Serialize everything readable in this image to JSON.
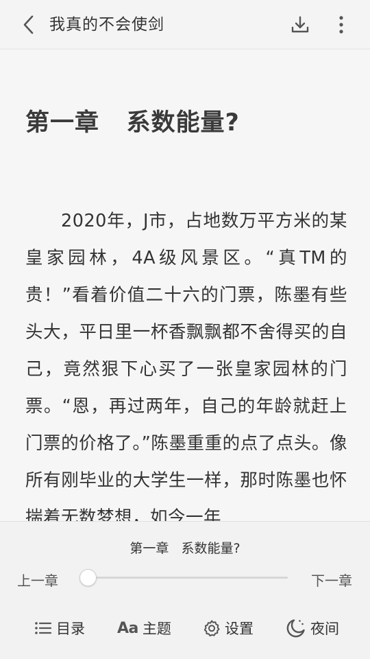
{
  "header": {
    "book_title": "我真的不会使剑",
    "back_icon": "chevron-left-icon",
    "download_icon": "download-icon",
    "more_icon": "more-vertical-icon"
  },
  "content": {
    "chapter_title": "第一章   系数能量?",
    "paragraph": "2020年，J市，占地数万平方米的某皇家园林，4A级风景区。“真TM的贵！”看着价值二十六的门票，陈墨有些头大，平日里一杯香飘飘都不舍得买的自己，竟然狠下心买了一张皇家园林的门票。“恩，再过两年，自己的年龄就赶上门票的价格了。”陈墨重重的点了点头。像所有刚毕业的大学生一样，那时陈墨也怀揣着无数梦想，如今一年"
  },
  "bottom_panel": {
    "current_chapter": "第一章   系数能量?",
    "prev_label": "上一章",
    "next_label": "下一章",
    "progress": 0.0,
    "menu": {
      "toc_label": "目录",
      "theme_glyph": "Aa",
      "theme_label": "主题",
      "settings_label": "设置",
      "night_label": "夜间"
    }
  }
}
